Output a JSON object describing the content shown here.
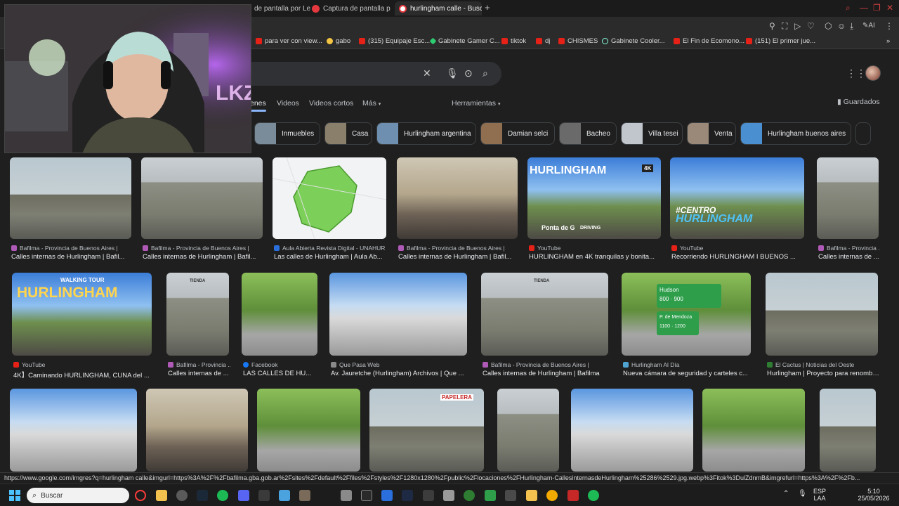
{
  "tabs": [
    {
      "label": "de pantalla por Le"
    },
    {
      "label": "Captura de pantalla por Le"
    },
    {
      "label": "hurlingham calle - Buscar"
    }
  ],
  "toolbar": {
    "ai_label": "AI"
  },
  "bookmarks": [
    {
      "label": "para ver con view..."
    },
    {
      "label": "gabo"
    },
    {
      "label": "(315) Equipaje Esc..."
    },
    {
      "label": "Gabinete Gamer C..."
    },
    {
      "label": "tiktok"
    },
    {
      "label": "dj"
    },
    {
      "label": "CHISMES"
    },
    {
      "label": "Gabinete Cooler..."
    },
    {
      "label": "El Fin de Ecomono..."
    },
    {
      "label": "(151) El primer jue..."
    }
  ],
  "search": {
    "query": ""
  },
  "nav": {
    "imagenes": "enes",
    "videos": "Videos",
    "cortos": "Videos cortos",
    "mas": "Más",
    "herramientas": "Herramientas",
    "guardados": "Guardados"
  },
  "chips": [
    {
      "label": "Inmuebles",
      "color": "#7a8b99"
    },
    {
      "label": "Casa",
      "color": "#8a7f6a"
    },
    {
      "label": "Hurlingham argentina",
      "color": "#6f8fb0"
    },
    {
      "label": "Damian selci",
      "color": "#8f6f50"
    },
    {
      "label": "Bacheo",
      "color": "#6a6a6a"
    },
    {
      "label": "Villa tesei",
      "color": "#c0c6cc"
    },
    {
      "label": "Venta",
      "color": "#9a8878"
    },
    {
      "label": "Hurlingham buenos aires",
      "color": "#4a8fd0"
    }
  ],
  "results_row1": [
    {
      "source": "Bafilma - Provincia de Buenos Aires |",
      "title": "Calles internas de Hurlingham | Bafil...",
      "fav": "b",
      "pic": "pic-street"
    },
    {
      "source": "Bafilma - Provincia de Buenos Aires |",
      "title": "Calles internas de Hurlingham | Bafil...",
      "fav": "b",
      "pic": "pic-house"
    },
    {
      "source": "Aula Abierta Revista Digital - UNAHUR",
      "title": "Las calles de Hurlingham | Aula Ab...",
      "fav": "u",
      "pic": "pic-map"
    },
    {
      "source": "Bafilma - Provincia de Buenos Aires |",
      "title": "Calles internas de Hurlingham | Bafil...",
      "fav": "b",
      "pic": "pic-old"
    },
    {
      "source": "YouTube",
      "title": "HURLINGHAM en 4K tranquilas y bonita...",
      "fav": "yt",
      "pic": "pic-sky"
    },
    {
      "source": "YouTube",
      "title": "Recorriendo HURLINGHAM I BUENOS ...",
      "fav": "yt",
      "pic": "pic-sky"
    },
    {
      "source": "Bafilma - Provincia ...",
      "title": "Calles internas de ...",
      "fav": "b",
      "pic": "pic-house"
    }
  ],
  "results_row2": [
    {
      "source": "YouTube",
      "title": "4K】Caminando HURLINGHAM, CUNA del ...",
      "fav": "yt",
      "pic": "pic-sky"
    },
    {
      "source": "Bafilma - Provincia ...",
      "title": "Calles internas de ...",
      "fav": "b",
      "pic": "pic-house"
    },
    {
      "source": "Facebook",
      "title": "LAS CALLES DE HU...",
      "fav": "fb",
      "pic": "pic-trees"
    },
    {
      "source": "Que Pasa Web",
      "title": "Av. Jauretche (Hurlingham) Archivos | Que ...",
      "fav": "q",
      "pic": "pic-city"
    },
    {
      "source": "Bafilma - Provincia de Buenos Aires |",
      "title": "Calles internas de Hurlingham | Bafilma",
      "fav": "b",
      "pic": "pic-house"
    },
    {
      "source": "Hurlingham Al Día",
      "title": "Nueva cámara de seguridad y carteles c...",
      "fav": "h",
      "pic": "pic-trees"
    },
    {
      "source": "El Cactus | Noticias del Oeste",
      "title": "Hurlingham | Proyecto para renombr...",
      "fav": "c",
      "pic": "pic-street"
    }
  ],
  "results_row3": [
    {
      "pic": "pic-city"
    },
    {
      "pic": "pic-old"
    },
    {
      "pic": "pic-trees"
    },
    {
      "pic": "pic-street"
    },
    {
      "pic": "pic-house"
    },
    {
      "pic": "pic-city"
    },
    {
      "pic": "pic-trees"
    },
    {
      "pic": "pic-street"
    }
  ],
  "overlay_text": {
    "row1_4k": "4K",
    "hurlingham_a": "HURLINGHAM",
    "ponta": "Ponta de G",
    "driving": "DRIVING",
    "centro": "#CENTRO",
    "hurlingham_b": "HURLINGHAM",
    "walking": "WALKING TOUR",
    "hurlingham_c": "HURLINGHAM",
    "tienda": "TIENDA",
    "papelera": "PAPELERA",
    "hudson": "Hudson",
    "hudson_num": "800 · 900",
    "mendoza": "P. de Mendoza",
    "mendoza_num": "1100 · 1200"
  },
  "status_url": "https://www.google.com/imgres?q=hurlingham calle&imgurl=https%3A%2F%2Fbafilma.gba.gob.ar%2Fsites%2Fdefault%2Ffiles%2Fstyles%2F1280x1280%2Fpublic%2Flocaciones%2FHurlingham-CallesinternasdeHurlingham%25286%2529.jpg.webp%3Fitok%3DulZdnmB&imgrefurl=https%3A%2F%2Fb...",
  "taskbar": {
    "search_label": "Buscar",
    "lang": "ESP",
    "lang2": "LAA",
    "time": "5:10",
    "date": "25/05/2026"
  }
}
